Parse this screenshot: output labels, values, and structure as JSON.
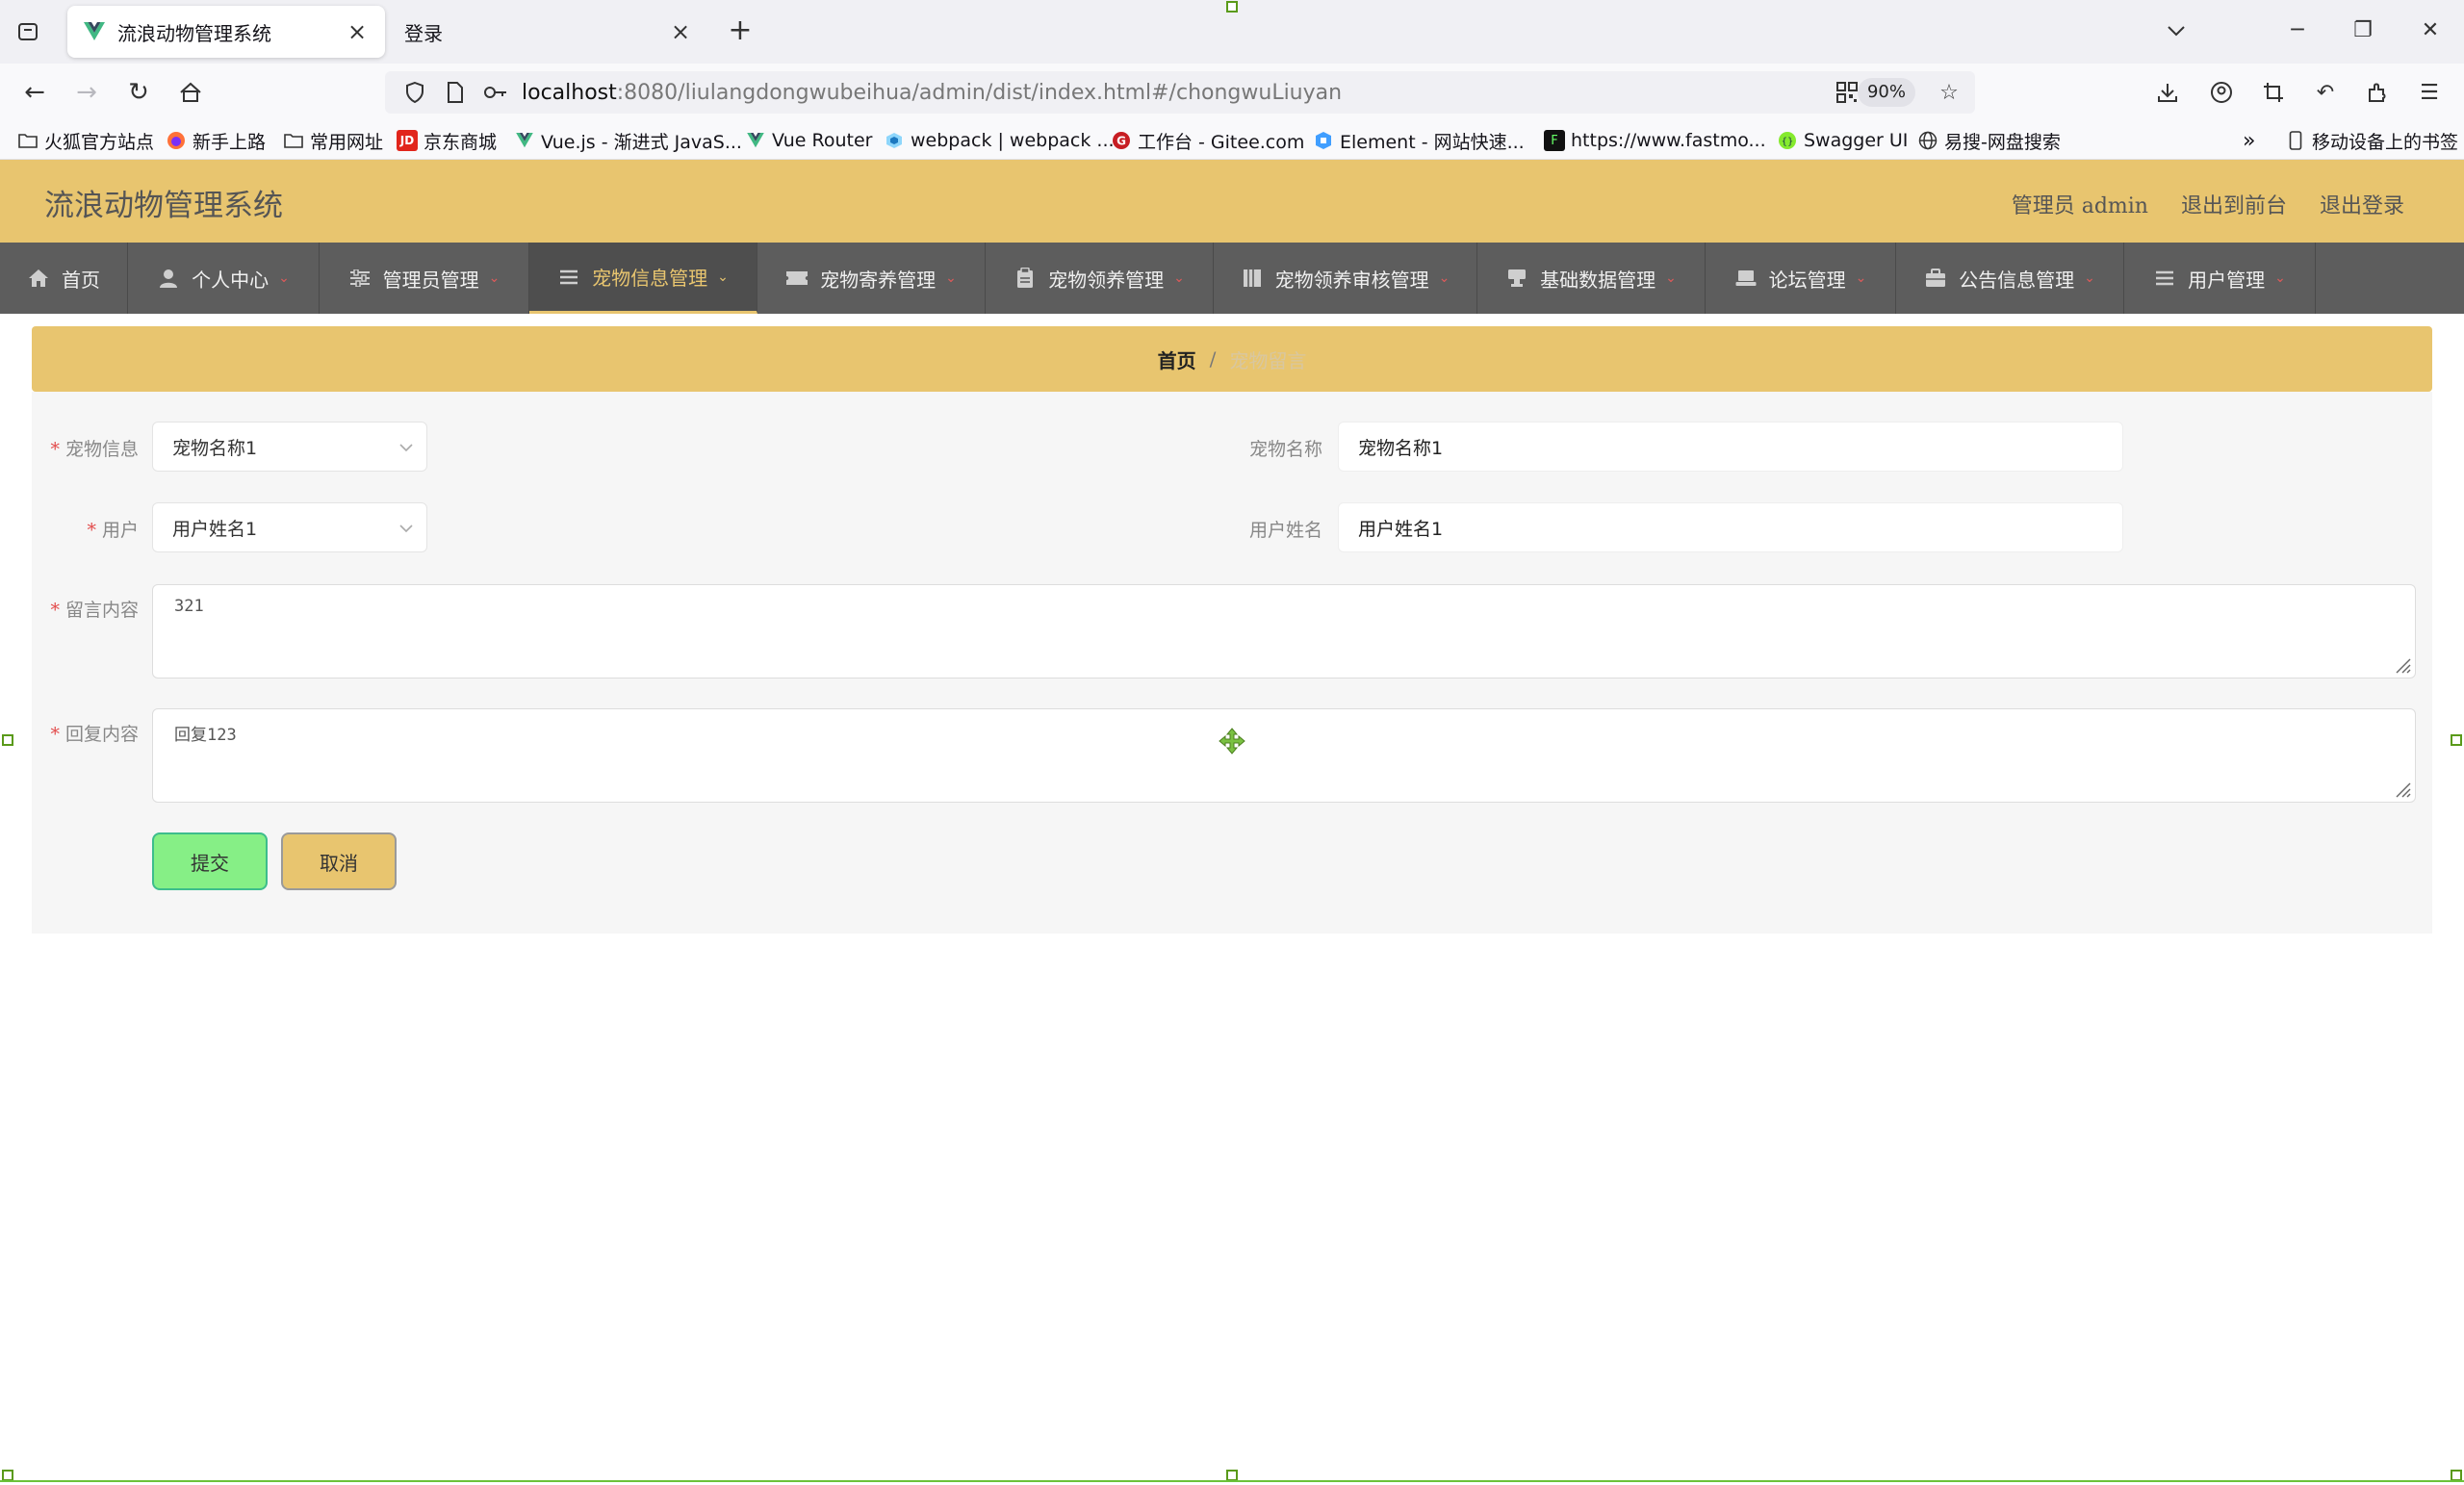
{
  "browser": {
    "tabs": [
      {
        "title": "流浪动物管理系统",
        "active": true
      },
      {
        "title": "登录",
        "active": false
      }
    ],
    "url_host": "localhost",
    "url_rest": ":8080/liulangdongwubeihua/admin/dist/index.html#/chongwuLiuyan",
    "zoom": "90%",
    "bookmarks": [
      "火狐官方站点",
      "新手上路",
      "常用网址",
      "京东商城",
      "Vue.js - 渐进式 JavaS...",
      "Vue Router",
      "webpack | webpack ...",
      "工作台 - Gitee.com",
      "Element - 网站快速...",
      "https://www.fastmo...",
      "Swagger UI",
      "易搜-网盘搜索"
    ],
    "mobile_bookmarks": "移动设备上的书签"
  },
  "app": {
    "title": "流浪动物管理系统",
    "header_links": [
      "管理员 admin",
      "退出到前台",
      "退出登录"
    ],
    "menu": [
      {
        "label": "首页",
        "icon": "home-icon",
        "has_caret": false
      },
      {
        "label": "个人中心",
        "icon": "user-icon",
        "has_caret": true
      },
      {
        "label": "管理员管理",
        "icon": "sliders-icon",
        "has_caret": true
      },
      {
        "label": "宠物信息管理",
        "icon": "list-icon",
        "has_caret": true,
        "active": true
      },
      {
        "label": "宠物寄养管理",
        "icon": "ticket-icon",
        "has_caret": true
      },
      {
        "label": "宠物领养管理",
        "icon": "clipboard-icon",
        "has_caret": true
      },
      {
        "label": "宠物领养审核管理",
        "icon": "book-icon",
        "has_caret": true
      },
      {
        "label": "基础数据管理",
        "icon": "stamp-icon",
        "has_caret": true
      },
      {
        "label": "论坛管理",
        "icon": "laptop-icon",
        "has_caret": true
      },
      {
        "label": "公告信息管理",
        "icon": "briefcase-icon",
        "has_caret": true
      },
      {
        "label": "用户管理",
        "icon": "menu-icon",
        "has_caret": true
      }
    ],
    "breadcrumb": {
      "home": "首页",
      "separator": "/",
      "current": "宠物留言"
    },
    "form": {
      "pet_info_label": "宠物信息",
      "pet_info_value": "宠物名称1",
      "pet_name_label": "宠物名称",
      "pet_name_value": "宠物名称1",
      "user_label": "用户",
      "user_value": "用户姓名1",
      "user_name_label": "用户姓名",
      "user_name_value": "用户姓名1",
      "message_label": "留言内容",
      "message_value": "321",
      "reply_label": "回复内容",
      "reply_value": "回复123",
      "submit_label": "提交",
      "cancel_label": "取消"
    },
    "colors": {
      "accent": "#e8c56f",
      "menu_bg": "#5d5d5d",
      "submit_bg": "#86ef86",
      "required": "#e24a4a"
    }
  }
}
